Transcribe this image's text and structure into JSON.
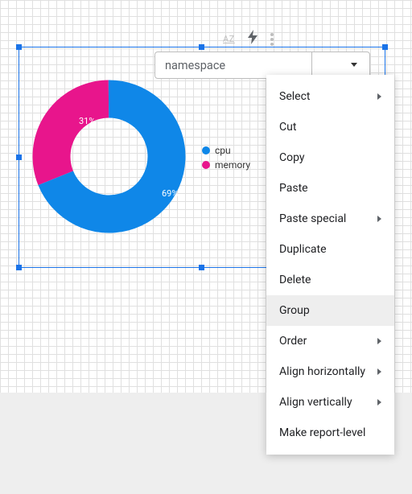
{
  "toolbar": {
    "az_label": "AZ"
  },
  "dropdown": {
    "label": "namespace"
  },
  "legend": {
    "items": [
      {
        "label": "cpu",
        "color": "#0f87e8"
      },
      {
        "label": "memory",
        "color": "#e8158c"
      }
    ]
  },
  "chart_data": {
    "type": "pie",
    "donut": true,
    "series": [
      {
        "name": "cpu",
        "value": 69,
        "label": "69%",
        "color": "#0f87e8"
      },
      {
        "name": "memory",
        "value": 31,
        "label": "31%",
        "color": "#e8158c"
      }
    ]
  },
  "context_menu": {
    "items": [
      {
        "label": "Select",
        "submenu": true
      },
      {
        "label": "Cut",
        "submenu": false
      },
      {
        "label": "Copy",
        "submenu": false
      },
      {
        "label": "Paste",
        "submenu": false
      },
      {
        "label": "Paste special",
        "submenu": true
      },
      {
        "label": "Duplicate",
        "submenu": false
      },
      {
        "label": "Delete",
        "submenu": false
      },
      {
        "label": "Group",
        "submenu": false,
        "hover": true
      },
      {
        "label": "Order",
        "submenu": true
      },
      {
        "label": "Align horizontally",
        "submenu": true
      },
      {
        "label": "Align vertically",
        "submenu": true
      },
      {
        "label": "Make report-level",
        "submenu": false
      }
    ]
  }
}
